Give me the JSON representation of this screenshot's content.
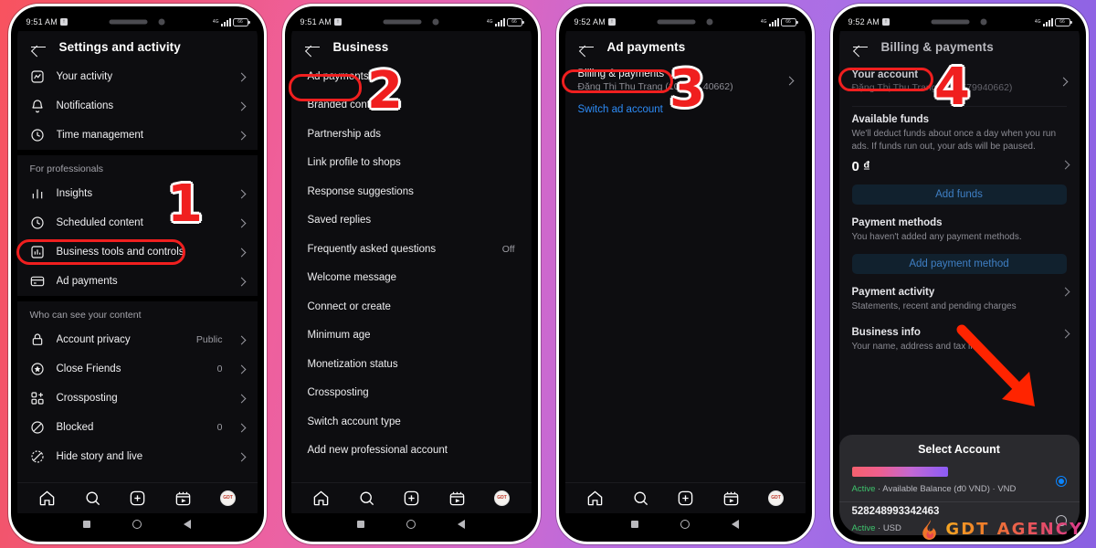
{
  "colors": {
    "accent_red": "#f01f1f",
    "link_blue": "#2d8cf7",
    "active_green": "#3ec46d",
    "radio_blue": "#0a84ff",
    "bg_gradient_start": "#f8535f",
    "bg_gradient_end": "#8a60e2"
  },
  "screens": [
    {
      "status_bar": {
        "time": "9:51 AM",
        "badge": "↑",
        "network": "4G",
        "battery": "66"
      },
      "header": {
        "title": "Settings and activity",
        "back_icon": "back-arrow-icon"
      },
      "step_number": "1",
      "groups": [
        {
          "header": "",
          "items": [
            {
              "label": "Your activity",
              "icon": "activity-chart-icon",
              "value": "",
              "chevron": true
            },
            {
              "label": "Notifications",
              "icon": "bell-icon",
              "value": "",
              "chevron": true
            },
            {
              "label": "Time management",
              "icon": "clock-icon",
              "value": "",
              "chevron": true
            }
          ]
        },
        {
          "header": "For professionals",
          "items": [
            {
              "label": "Insights",
              "icon": "bar-chart-icon",
              "value": "",
              "chevron": true
            },
            {
              "label": "Scheduled content",
              "icon": "clock-icon",
              "value": "",
              "chevron": true
            },
            {
              "label": "Business tools and controls",
              "icon": "business-tools-icon",
              "value": "",
              "chevron": true,
              "highlighted": true
            },
            {
              "label": "Ad payments",
              "icon": "credit-card-icon",
              "value": "",
              "chevron": true
            }
          ]
        },
        {
          "header": "Who can see your content",
          "items": [
            {
              "label": "Account privacy",
              "icon": "lock-icon",
              "value": "Public",
              "chevron": true
            },
            {
              "label": "Close Friends",
              "icon": "star-circle-icon",
              "value": "0",
              "chevron": true
            },
            {
              "label": "Crossposting",
              "icon": "crossposting-icon",
              "value": "",
              "chevron": true
            },
            {
              "label": "Blocked",
              "icon": "blocked-icon",
              "value": "0",
              "chevron": true
            },
            {
              "label": "Hide story and live",
              "icon": "hide-story-icon",
              "value": "",
              "chevron": true
            }
          ]
        }
      ]
    },
    {
      "status_bar": {
        "time": "9:51 AM",
        "badge": "↑",
        "network": "4G",
        "battery": "66"
      },
      "header": {
        "title": "Business",
        "back_icon": "back-arrow-icon"
      },
      "step_number": "2",
      "items": [
        {
          "label": "Ad payments",
          "value": "",
          "highlighted": true
        },
        {
          "label": "Branded content",
          "value": ""
        },
        {
          "label": "Partnership ads",
          "value": ""
        },
        {
          "label": "Link profile to shops",
          "value": ""
        },
        {
          "label": "Response suggestions",
          "value": ""
        },
        {
          "label": "Saved replies",
          "value": ""
        },
        {
          "label": "Frequently asked questions",
          "value": "Off"
        },
        {
          "label": "Welcome message",
          "value": ""
        },
        {
          "label": "Connect or create",
          "value": ""
        },
        {
          "label": "Minimum age",
          "value": ""
        },
        {
          "label": "Monetization status",
          "value": ""
        },
        {
          "label": "Crossposting",
          "value": ""
        },
        {
          "label": "Switch account type",
          "value": ""
        },
        {
          "label": "Add new professional account",
          "value": ""
        }
      ]
    },
    {
      "status_bar": {
        "time": "9:52 AM",
        "badge": "↑",
        "network": "4G",
        "battery": "66"
      },
      "header": {
        "title": "Ad payments",
        "back_icon": "back-arrow-icon"
      },
      "step_number": "3",
      "billing_row": {
        "title": "Billing & payments",
        "subtitle": "Đặng Thị Thu Trang (10843...40662)",
        "highlighted": true
      },
      "switch_link": "Switch ad account"
    },
    {
      "status_bar": {
        "time": "9:52 AM",
        "badge": "↑",
        "network": "4G",
        "battery": "66"
      },
      "header": {
        "title": "Billing & payments",
        "back_icon": "back-arrow-icon"
      },
      "step_number": "4",
      "account_row": {
        "title": "Your account",
        "subtitle": "Đặng Thị Thu Trang (10...579940662)",
        "highlighted": true
      },
      "available_funds": {
        "title": "Available funds",
        "description": "We'll deduct funds about once a day when you run ads. If funds run out, your ads will be paused.",
        "amount": "0 ₫",
        "button": "Add funds"
      },
      "payment_methods": {
        "title": "Payment methods",
        "description": "You haven't added any payment methods.",
        "button": "Add payment method"
      },
      "payment_activity": {
        "title": "Payment activity",
        "description": "Statements, recent and pending charges"
      },
      "business_info": {
        "title": "Business info",
        "description": "Your name, address and tax info"
      },
      "sheet": {
        "title": "Select Account",
        "accounts": [
          {
            "name_redacted": true,
            "name": "",
            "meta_status": "Active",
            "meta_rest": "· Available Balance (đ0 VND) · VND",
            "selected": true
          },
          {
            "name_redacted": false,
            "name": "528248993342463",
            "meta_status": "Active",
            "meta_rest": "· USD",
            "selected": false
          }
        ]
      }
    }
  ],
  "bottom_nav": {
    "items": [
      {
        "icon": "home-icon",
        "label": "Home"
      },
      {
        "icon": "search-icon",
        "label": "Search"
      },
      {
        "icon": "create-plus-icon",
        "label": "Create"
      },
      {
        "icon": "reels-icon",
        "label": "Reels"
      },
      {
        "icon": "profile-avatar-icon",
        "label": "Profile"
      }
    ]
  },
  "soft_keys": [
    {
      "icon": "recents-square-icon"
    },
    {
      "icon": "home-circle-icon"
    },
    {
      "icon": "back-triangle-icon"
    }
  ],
  "watermark": {
    "text": "GDT AGENCY",
    "logo": "gdt-flame-logo"
  }
}
